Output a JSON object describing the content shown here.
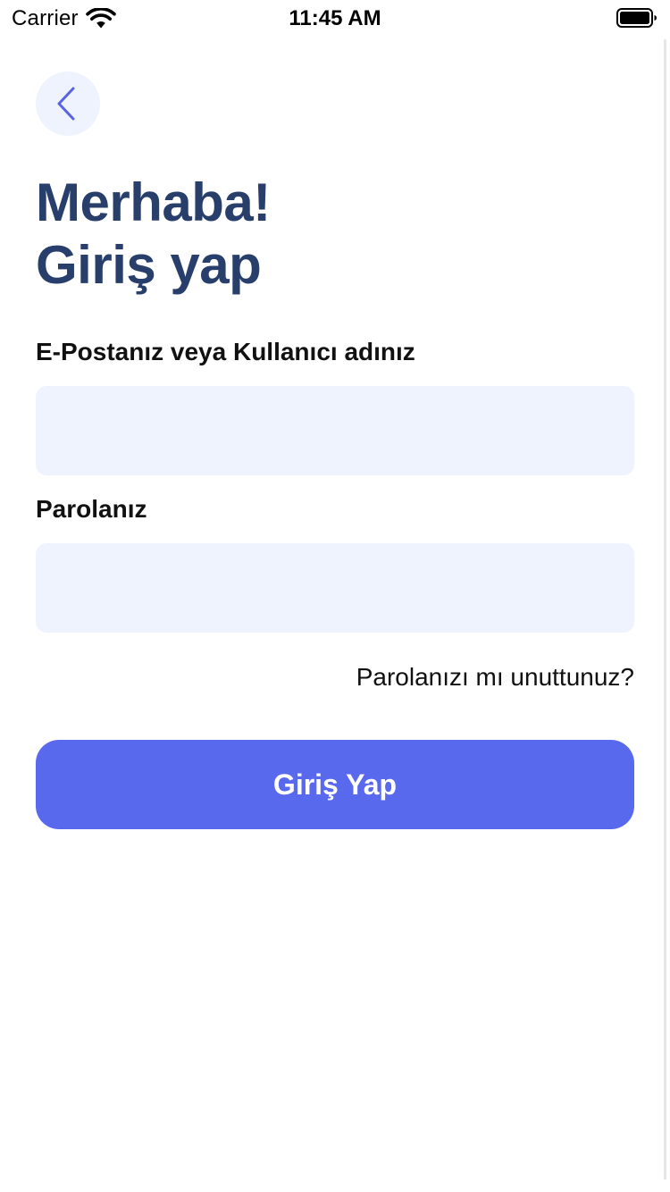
{
  "status_bar": {
    "carrier": "Carrier",
    "time": "11:45 AM",
    "wifi_icon": "wifi-icon",
    "battery_icon": "battery-full-icon"
  },
  "back_button": {
    "icon": "chevron-left-icon"
  },
  "heading": {
    "line1": "Merhaba!",
    "line2": "Giriş yap"
  },
  "form": {
    "email_label": "E-Postanız veya Kullanıcı adınız",
    "email_value": "",
    "email_placeholder": "",
    "password_label": "Parolanız",
    "password_value": "",
    "password_placeholder": "",
    "forgot_password": "Parolanızı mı unuttunuz?",
    "submit_label": "Giriş Yap"
  },
  "colors": {
    "heading": "#283f6c",
    "accent": "#5969ee",
    "input_background": "#eff3fd",
    "back_icon": "#5a64e0"
  }
}
